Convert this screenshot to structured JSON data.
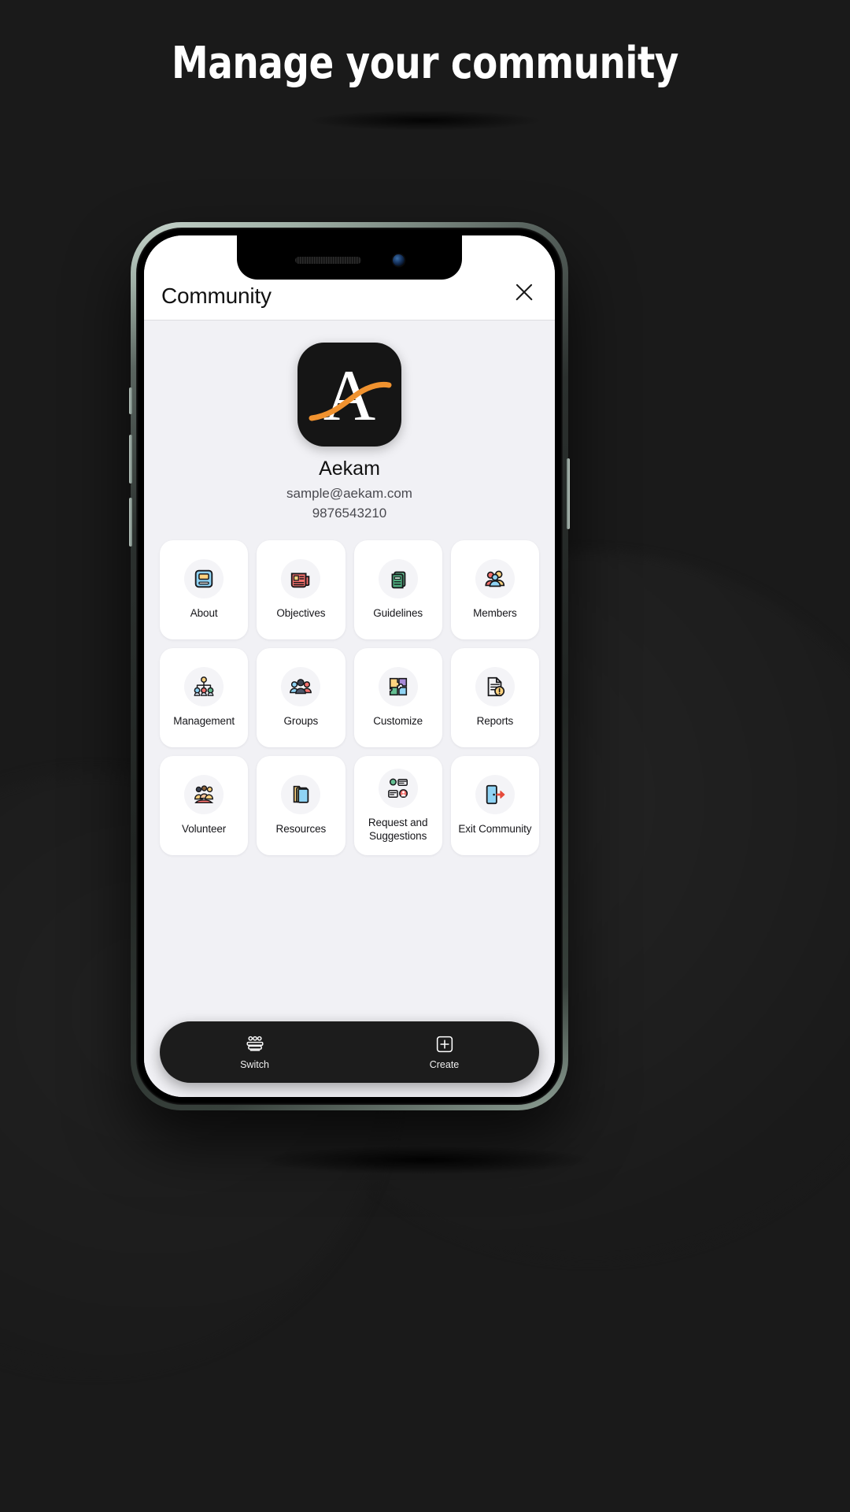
{
  "headline": "Manage your community",
  "phone": {
    "notch": {
      "speaker": "speaker-grille",
      "camera": "front-camera"
    }
  },
  "app": {
    "header": {
      "title": "Community",
      "close_label": "close-icon"
    },
    "profile": {
      "logo_letter": "A",
      "logo_bg": "#151515",
      "logo_accent": "#f0922f",
      "name": "Aekam",
      "email": "sample@aekam.com",
      "phone": "9876543210"
    },
    "grid": [
      {
        "label": "About",
        "icon": "book-icon"
      },
      {
        "label": "Objectives",
        "icon": "newspaper-icon"
      },
      {
        "label": "Guidelines",
        "icon": "documents-icon"
      },
      {
        "label": "Members",
        "icon": "people-icon"
      },
      {
        "label": "Management",
        "icon": "org-chart-icon"
      },
      {
        "label": "Groups",
        "icon": "group-icon"
      },
      {
        "label": "Customize",
        "icon": "puzzle-icon"
      },
      {
        "label": "Reports",
        "icon": "report-warning-icon"
      },
      {
        "label": "Volunteer",
        "icon": "volunteer-hands-icon"
      },
      {
        "label": "Resources",
        "icon": "folder-files-icon"
      },
      {
        "label": "Request and\nSuggestions",
        "icon": "request-suggestion-icon"
      },
      {
        "label": "Exit Community",
        "icon": "exit-door-icon"
      }
    ],
    "bottombar": [
      {
        "label": "Switch",
        "icon": "switch-accounts-icon"
      },
      {
        "label": "Create",
        "icon": "plus-square-icon"
      }
    ]
  }
}
